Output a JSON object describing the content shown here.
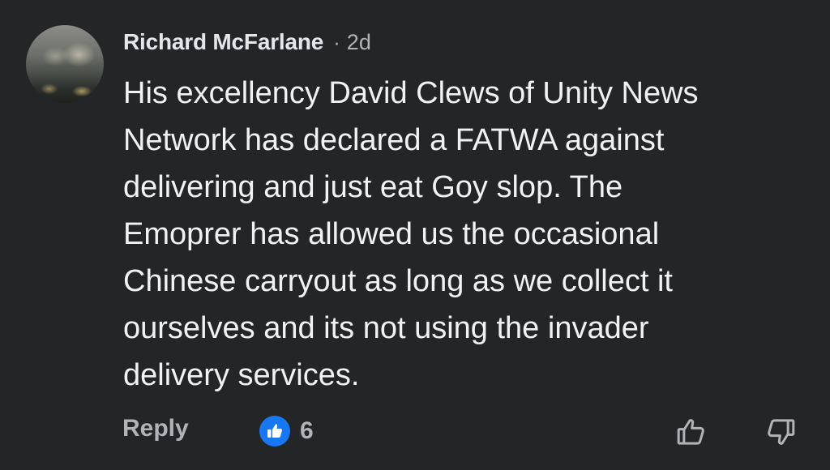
{
  "comment": {
    "author": "Richard McFarlane",
    "separator": "·",
    "timestamp": "2d",
    "text": "His excellency David Clews of Unity News\nNetwork has declared a FATWA against\ndelivering and just eat Goy slop. The\nEmoprer has allowed us the occasional\nChinese carryout as long as we collect it\nourselves and its not using the invader\ndelivery services.",
    "actions": {
      "reply_label": "Reply",
      "reaction_count": "6"
    }
  },
  "icons": {
    "reaction": "thumbs-up-icon",
    "upvote": "thumbs-up-outline-icon",
    "downvote": "thumbs-down-outline-icon"
  },
  "colors": {
    "background": "#242526",
    "primary_text": "#e4e6eb",
    "secondary_text": "#b0b3b8",
    "like_blue": "#1877f2"
  }
}
